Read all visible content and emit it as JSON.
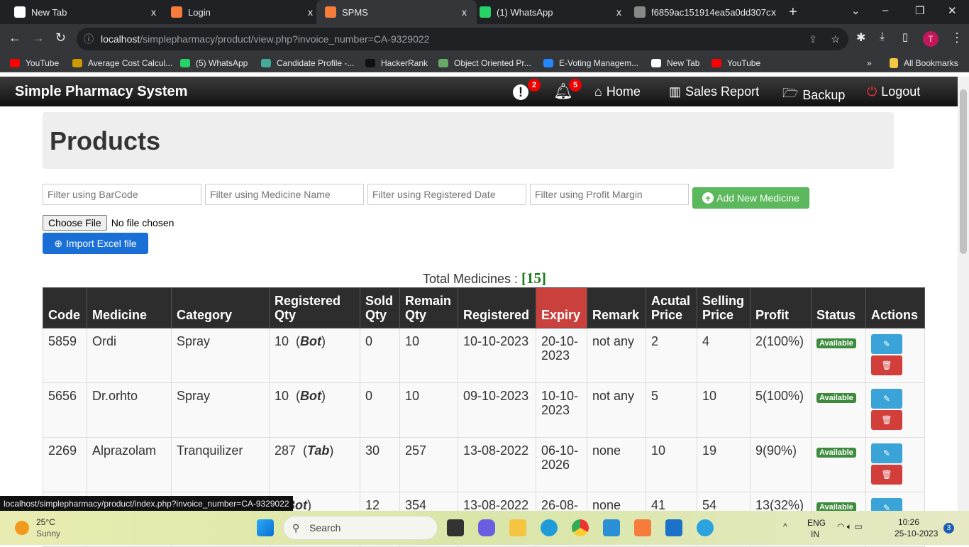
{
  "browser": {
    "tabs": [
      {
        "title": "New Tab",
        "color": "#fff"
      },
      {
        "title": "Login",
        "color": "#f57c3b"
      },
      {
        "title": "SPMS",
        "color": "#f57c3b"
      },
      {
        "title": "(1) WhatsApp",
        "color": "#25d366"
      },
      {
        "title": "f6859ac151914ea5a0dd307c",
        "color": "#888"
      }
    ],
    "new_tab": "+",
    "close": "x",
    "url_host": "localhost",
    "url_path": "/simplepharmacy/product/view.php?invoice_number=CA-9329022",
    "avatar": "T",
    "bookmarks": [
      {
        "label": "YouTube",
        "color": "#f00"
      },
      {
        "label": "Average Cost Calcul...",
        "color": "#c90"
      },
      {
        "label": "(5) WhatsApp",
        "color": "#25d366"
      },
      {
        "label": "Candidate Profile -...",
        "color": "#4a9"
      },
      {
        "label": "HackerRank",
        "color": "#111"
      },
      {
        "label": "Object Oriented Pr...",
        "color": "#6a6"
      },
      {
        "label": "E-Voting Managem...",
        "color": "#28f"
      },
      {
        "label": "New Tab",
        "color": "#fff"
      },
      {
        "label": "YouTube",
        "color": "#f00"
      }
    ],
    "more": "»",
    "all_bookmarks": "All Bookmarks"
  },
  "navbar": {
    "brand": "Simple Pharmacy System",
    "alerts_count": "2",
    "notifications_count": "5",
    "home": "Home",
    "sales_report": "Sales Report",
    "backup": "Backup",
    "logout": "Logout"
  },
  "page": {
    "title": "Products",
    "filters": {
      "barcode": "Filter using BarCode",
      "name": "Filter using Medicine Name",
      "date": "Filter using Registered Date",
      "profit": "Filter using Profit Margin"
    },
    "add_button": "Add New Medicine",
    "choose_file": "Choose File",
    "no_file": "No file chosen",
    "import_button": "Import Excel file",
    "total_label": "Total Medicines :",
    "total_value": "[15]"
  },
  "table": {
    "headers": [
      "Code",
      "Medicine",
      "Category",
      "Registered Qty",
      "Sold Qty",
      "Remain Qty",
      "Registered",
      "Expiry",
      "Remark",
      "Acutal Price",
      "Selling Price",
      "Profit",
      "Status",
      "Actions"
    ],
    "rows": [
      {
        "code": "5859",
        "medicine": "Ordi",
        "category": "Spray",
        "qty": "10",
        "unit": "Bot",
        "sold": "0",
        "remain": "10",
        "registered": "10-10-2023",
        "expiry": "20-10-2023",
        "remark": "not any",
        "actual": "2",
        "selling": "4",
        "profit": "2(100%)",
        "status": "Available"
      },
      {
        "code": "5656",
        "medicine": "Dr.orhto",
        "category": "Spray",
        "qty": "10",
        "unit": "Bot",
        "sold": "0",
        "remain": "10",
        "registered": "09-10-2023",
        "expiry": "10-10-2023",
        "remark": "not any",
        "actual": "5",
        "selling": "10",
        "profit": "5(100%)",
        "status": "Available"
      },
      {
        "code": "2269",
        "medicine": "Alprazolam",
        "category": "Tranquilizer",
        "qty": "287",
        "unit": "Tab",
        "sold": "30",
        "remain": "257",
        "registered": "13-08-2022",
        "expiry": "06-10-2026",
        "remark": "none",
        "actual": "10",
        "selling": "19",
        "profit": "9(90%)",
        "status": "Available"
      },
      {
        "code": "",
        "medicine": "",
        "category": "",
        "qty": "",
        "unit": "Bot",
        "sold": "12",
        "remain": "354",
        "registered": "13-08-2022",
        "expiry": "26-08-",
        "remark": "none",
        "actual": "41",
        "selling": "54",
        "profit": "13(32%)",
        "status": "Available"
      }
    ]
  },
  "status_bar": "localhost/simplepharmacy/product/index.php?invoice_number=CA-9329022",
  "taskbar": {
    "temp": "25°C",
    "weather": "Sunny",
    "search": "Search",
    "lang1": "ENG",
    "lang2": "IN",
    "time": "10:26",
    "date": "25-10-2023",
    "notif": "3"
  }
}
